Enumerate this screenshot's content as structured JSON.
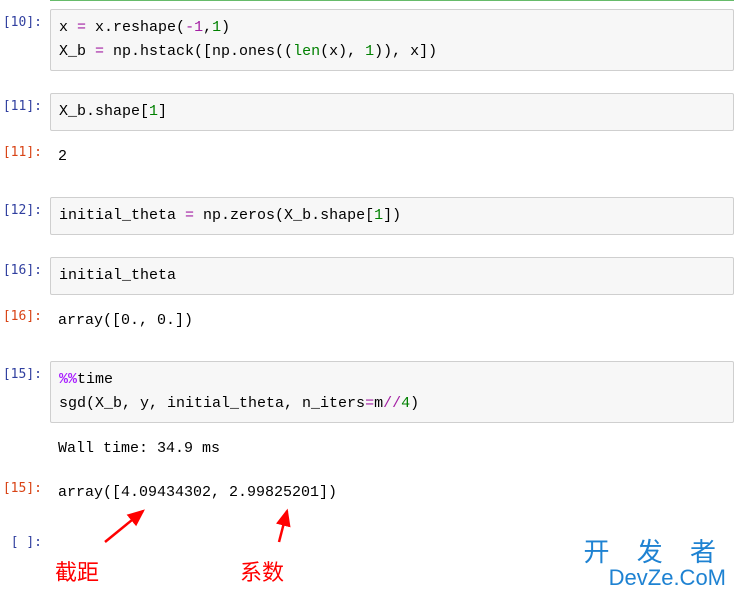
{
  "cells": {
    "c10": {
      "in_prompt": "[10]:",
      "line1_a": "x ",
      "line1_op": "=",
      "line1_b": " x.reshape(",
      "line1_n1": "-1",
      "line1_c": ",",
      "line1_n2": "1",
      "line1_d": ")",
      "line2_a": "X_b ",
      "line2_op": "=",
      "line2_b": " np.hstack([np.ones((",
      "line2_len": "len",
      "line2_c": "(x), ",
      "line2_n1": "1",
      "line2_d": ")), x])"
    },
    "c11": {
      "in_prompt": "[11]:",
      "code": "X_b.shape[",
      "idx": "1",
      "code2": "]",
      "out_prompt": "[11]:",
      "output": "2"
    },
    "c12": {
      "in_prompt": "[12]:",
      "l_a": "initial_theta ",
      "l_op": "=",
      "l_b": " np.zeros(X_b.shape[",
      "l_n": "1",
      "l_c": "])"
    },
    "c16": {
      "in_prompt": "[16]:",
      "code": "initial_theta",
      "out_prompt": "[16]:",
      "output": "array([0., 0.])"
    },
    "c15": {
      "in_prompt": "[15]:",
      "magic": "%%",
      "magic2": "time",
      "l2": "sgd(X_b, y, initial_theta, n_iters",
      "l2op": "=",
      "l2b": "m",
      "l2c": "//",
      "l2n": "4",
      "l2d": ")",
      "wall": "Wall time: 34.9 ms",
      "out_prompt": "[15]:",
      "output": "array([4.09434302, 2.99825201])"
    },
    "empty": {
      "in_prompt": "[ ]:"
    }
  },
  "annotations": {
    "intercept": "截距",
    "coef": "系数"
  },
  "watermark": {
    "cn": "开 发 者",
    "en": "DevZe.CoM"
  }
}
